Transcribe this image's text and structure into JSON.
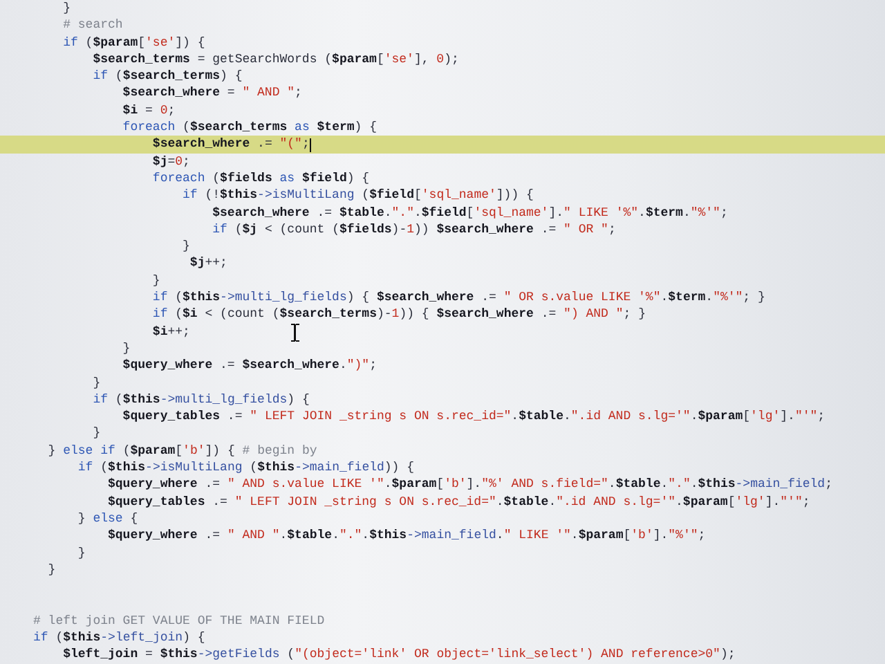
{
  "editor": {
    "lines": [
      {
        "current": false,
        "segments": [
          {
            "kind": "txt",
            "text": "    }"
          }
        ]
      },
      {
        "current": false,
        "segments": [
          {
            "kind": "com",
            "text": "    # search"
          }
        ]
      },
      {
        "current": false,
        "segments": [
          {
            "kind": "kw",
            "text": "    if"
          },
          {
            "kind": "txt",
            "text": " ("
          },
          {
            "kind": "var",
            "text": "$param"
          },
          {
            "kind": "txt",
            "text": "["
          },
          {
            "kind": "str",
            "text": "'se'"
          },
          {
            "kind": "txt",
            "text": "]) {"
          }
        ]
      },
      {
        "current": false,
        "segments": [
          {
            "kind": "var",
            "text": "        $search_terms"
          },
          {
            "kind": "txt",
            "text": " = getSearchWords ("
          },
          {
            "kind": "var",
            "text": "$param"
          },
          {
            "kind": "txt",
            "text": "["
          },
          {
            "kind": "str",
            "text": "'se'"
          },
          {
            "kind": "txt",
            "text": "], "
          },
          {
            "kind": "str",
            "text": "0"
          },
          {
            "kind": "txt",
            "text": ");"
          }
        ]
      },
      {
        "current": false,
        "segments": [
          {
            "kind": "kw",
            "text": "        if"
          },
          {
            "kind": "txt",
            "text": " ("
          },
          {
            "kind": "var",
            "text": "$search_terms"
          },
          {
            "kind": "txt",
            "text": ") {"
          }
        ]
      },
      {
        "current": false,
        "segments": [
          {
            "kind": "var",
            "text": "            $search_where"
          },
          {
            "kind": "txt",
            "text": " = "
          },
          {
            "kind": "str",
            "text": "\" AND \""
          },
          {
            "kind": "txt",
            "text": ";"
          }
        ]
      },
      {
        "current": false,
        "segments": [
          {
            "kind": "var",
            "text": "            $i"
          },
          {
            "kind": "txt",
            "text": " = "
          },
          {
            "kind": "str",
            "text": "0"
          },
          {
            "kind": "txt",
            "text": ";"
          }
        ]
      },
      {
        "current": false,
        "segments": [
          {
            "kind": "kw",
            "text": "            foreach"
          },
          {
            "kind": "txt",
            "text": " ("
          },
          {
            "kind": "var",
            "text": "$search_terms"
          },
          {
            "kind": "kw",
            "text": " as "
          },
          {
            "kind": "var",
            "text": "$term"
          },
          {
            "kind": "txt",
            "text": ") {"
          }
        ]
      },
      {
        "current": true,
        "segments": [
          {
            "kind": "var",
            "text": "                $search_where"
          },
          {
            "kind": "txt",
            "text": " .= "
          },
          {
            "kind": "str",
            "text": "\"(\""
          },
          {
            "kind": "txt",
            "text": ";"
          }
        ]
      },
      {
        "current": false,
        "segments": [
          {
            "kind": "var",
            "text": "                $j"
          },
          {
            "kind": "txt",
            "text": "="
          },
          {
            "kind": "str",
            "text": "0"
          },
          {
            "kind": "txt",
            "text": ";"
          }
        ]
      },
      {
        "current": false,
        "segments": [
          {
            "kind": "kw",
            "text": "                foreach"
          },
          {
            "kind": "txt",
            "text": " ("
          },
          {
            "kind": "var",
            "text": "$fields"
          },
          {
            "kind": "kw",
            "text": " as "
          },
          {
            "kind": "var",
            "text": "$field"
          },
          {
            "kind": "txt",
            "text": ") {"
          }
        ]
      },
      {
        "current": false,
        "segments": [
          {
            "kind": "kw",
            "text": "                    if"
          },
          {
            "kind": "txt",
            "text": " (!"
          },
          {
            "kind": "var",
            "text": "$this"
          },
          {
            "kind": "fn",
            "text": "->isMultiLang"
          },
          {
            "kind": "txt",
            "text": " ("
          },
          {
            "kind": "var",
            "text": "$field"
          },
          {
            "kind": "txt",
            "text": "["
          },
          {
            "kind": "str",
            "text": "'sql_name'"
          },
          {
            "kind": "txt",
            "text": "])) {"
          }
        ]
      },
      {
        "current": false,
        "segments": [
          {
            "kind": "var",
            "text": "                        $search_where"
          },
          {
            "kind": "txt",
            "text": " .= "
          },
          {
            "kind": "var",
            "text": "$table"
          },
          {
            "kind": "txt",
            "text": "."
          },
          {
            "kind": "str",
            "text": "\".\""
          },
          {
            "kind": "txt",
            "text": "."
          },
          {
            "kind": "var",
            "text": "$field"
          },
          {
            "kind": "txt",
            "text": "["
          },
          {
            "kind": "str",
            "text": "'sql_name'"
          },
          {
            "kind": "txt",
            "text": "]."
          },
          {
            "kind": "str",
            "text": "\" LIKE '%\""
          },
          {
            "kind": "txt",
            "text": "."
          },
          {
            "kind": "var",
            "text": "$term"
          },
          {
            "kind": "txt",
            "text": "."
          },
          {
            "kind": "str",
            "text": "\"%'\""
          },
          {
            "kind": "txt",
            "text": ";"
          }
        ]
      },
      {
        "current": false,
        "segments": [
          {
            "kind": "kw",
            "text": "                        if"
          },
          {
            "kind": "txt",
            "text": " ("
          },
          {
            "kind": "var",
            "text": "$j"
          },
          {
            "kind": "txt",
            "text": " < (count ("
          },
          {
            "kind": "var",
            "text": "$fields"
          },
          {
            "kind": "txt",
            "text": ")-"
          },
          {
            "kind": "str",
            "text": "1"
          },
          {
            "kind": "txt",
            "text": ")) "
          },
          {
            "kind": "var",
            "text": "$search_where"
          },
          {
            "kind": "txt",
            "text": " .= "
          },
          {
            "kind": "str",
            "text": "\" OR \""
          },
          {
            "kind": "txt",
            "text": ";"
          }
        ]
      },
      {
        "current": false,
        "segments": [
          {
            "kind": "txt",
            "text": "                    }"
          }
        ]
      },
      {
        "current": false,
        "segments": [
          {
            "kind": "var",
            "text": "                     $j"
          },
          {
            "kind": "txt",
            "text": "++;"
          }
        ]
      },
      {
        "current": false,
        "segments": [
          {
            "kind": "txt",
            "text": "                }"
          }
        ]
      },
      {
        "current": false,
        "segments": [
          {
            "kind": "kw",
            "text": "                if"
          },
          {
            "kind": "txt",
            "text": " ("
          },
          {
            "kind": "var",
            "text": "$this"
          },
          {
            "kind": "fn",
            "text": "->multi_lg_fields"
          },
          {
            "kind": "txt",
            "text": ") { "
          },
          {
            "kind": "var",
            "text": "$search_where"
          },
          {
            "kind": "txt",
            "text": " .= "
          },
          {
            "kind": "str",
            "text": "\" OR s.value LIKE '%\""
          },
          {
            "kind": "txt",
            "text": "."
          },
          {
            "kind": "var",
            "text": "$term"
          },
          {
            "kind": "txt",
            "text": "."
          },
          {
            "kind": "str",
            "text": "\"%'\""
          },
          {
            "kind": "txt",
            "text": "; }"
          }
        ]
      },
      {
        "current": false,
        "segments": [
          {
            "kind": "kw",
            "text": "                if"
          },
          {
            "kind": "txt",
            "text": " ("
          },
          {
            "kind": "var",
            "text": "$i"
          },
          {
            "kind": "txt",
            "text": " < (count ("
          },
          {
            "kind": "var",
            "text": "$search_terms"
          },
          {
            "kind": "txt",
            "text": ")-"
          },
          {
            "kind": "str",
            "text": "1"
          },
          {
            "kind": "txt",
            "text": ")) { "
          },
          {
            "kind": "var",
            "text": "$search_where"
          },
          {
            "kind": "txt",
            "text": " .= "
          },
          {
            "kind": "str",
            "text": "\") AND \""
          },
          {
            "kind": "txt",
            "text": "; }"
          }
        ]
      },
      {
        "current": false,
        "segments": [
          {
            "kind": "var",
            "text": "                $i"
          },
          {
            "kind": "txt",
            "text": "++;"
          }
        ]
      },
      {
        "current": false,
        "segments": [
          {
            "kind": "txt",
            "text": "            }"
          }
        ]
      },
      {
        "current": false,
        "segments": [
          {
            "kind": "var",
            "text": "            $query_where"
          },
          {
            "kind": "txt",
            "text": " .= "
          },
          {
            "kind": "var",
            "text": "$search_where"
          },
          {
            "kind": "txt",
            "text": "."
          },
          {
            "kind": "str",
            "text": "\")\""
          },
          {
            "kind": "txt",
            "text": ";"
          }
        ]
      },
      {
        "current": false,
        "segments": [
          {
            "kind": "txt",
            "text": "        }"
          }
        ]
      },
      {
        "current": false,
        "segments": [
          {
            "kind": "kw",
            "text": "        if"
          },
          {
            "kind": "txt",
            "text": " ("
          },
          {
            "kind": "var",
            "text": "$this"
          },
          {
            "kind": "fn",
            "text": "->multi_lg_fields"
          },
          {
            "kind": "txt",
            "text": ") {"
          }
        ]
      },
      {
        "current": false,
        "segments": [
          {
            "kind": "var",
            "text": "            $query_tables"
          },
          {
            "kind": "txt",
            "text": " .= "
          },
          {
            "kind": "str",
            "text": "\" LEFT JOIN _string s ON s.rec_id=\""
          },
          {
            "kind": "txt",
            "text": "."
          },
          {
            "kind": "var",
            "text": "$table"
          },
          {
            "kind": "txt",
            "text": "."
          },
          {
            "kind": "str",
            "text": "\".id AND s.lg='\""
          },
          {
            "kind": "txt",
            "text": "."
          },
          {
            "kind": "var",
            "text": "$param"
          },
          {
            "kind": "txt",
            "text": "["
          },
          {
            "kind": "str",
            "text": "'lg'"
          },
          {
            "kind": "txt",
            "text": "]."
          },
          {
            "kind": "str",
            "text": "\"'\""
          },
          {
            "kind": "txt",
            "text": ";"
          }
        ]
      },
      {
        "current": false,
        "segments": [
          {
            "kind": "txt",
            "text": "        }"
          }
        ]
      },
      {
        "current": false,
        "segments": [
          {
            "kind": "txt",
            "text": "  } "
          },
          {
            "kind": "kw",
            "text": "else if"
          },
          {
            "kind": "txt",
            "text": " ("
          },
          {
            "kind": "var",
            "text": "$param"
          },
          {
            "kind": "txt",
            "text": "["
          },
          {
            "kind": "str",
            "text": "'b'"
          },
          {
            "kind": "txt",
            "text": "]) { "
          },
          {
            "kind": "com",
            "text": "# begin by"
          }
        ]
      },
      {
        "current": false,
        "segments": [
          {
            "kind": "kw",
            "text": "      if"
          },
          {
            "kind": "txt",
            "text": " ("
          },
          {
            "kind": "var",
            "text": "$this"
          },
          {
            "kind": "fn",
            "text": "->isMultiLang"
          },
          {
            "kind": "txt",
            "text": " ("
          },
          {
            "kind": "var",
            "text": "$this"
          },
          {
            "kind": "fn",
            "text": "->main_field"
          },
          {
            "kind": "txt",
            "text": ")) {"
          }
        ]
      },
      {
        "current": false,
        "segments": [
          {
            "kind": "var",
            "text": "          $query_where"
          },
          {
            "kind": "txt",
            "text": " .= "
          },
          {
            "kind": "str",
            "text": "\" AND s.value LIKE '\""
          },
          {
            "kind": "txt",
            "text": "."
          },
          {
            "kind": "var",
            "text": "$param"
          },
          {
            "kind": "txt",
            "text": "["
          },
          {
            "kind": "str",
            "text": "'b'"
          },
          {
            "kind": "txt",
            "text": "]."
          },
          {
            "kind": "str",
            "text": "\"%' AND s.field=\""
          },
          {
            "kind": "txt",
            "text": "."
          },
          {
            "kind": "var",
            "text": "$table"
          },
          {
            "kind": "txt",
            "text": "."
          },
          {
            "kind": "str",
            "text": "\".\""
          },
          {
            "kind": "txt",
            "text": "."
          },
          {
            "kind": "var",
            "text": "$this"
          },
          {
            "kind": "fn",
            "text": "->main_field"
          },
          {
            "kind": "txt",
            "text": ";"
          }
        ]
      },
      {
        "current": false,
        "segments": [
          {
            "kind": "var",
            "text": "          $query_tables"
          },
          {
            "kind": "txt",
            "text": " .= "
          },
          {
            "kind": "str",
            "text": "\" LEFT JOIN _string s ON s.rec_id=\""
          },
          {
            "kind": "txt",
            "text": "."
          },
          {
            "kind": "var",
            "text": "$table"
          },
          {
            "kind": "txt",
            "text": "."
          },
          {
            "kind": "str",
            "text": "\".id AND s.lg='\""
          },
          {
            "kind": "txt",
            "text": "."
          },
          {
            "kind": "var",
            "text": "$param"
          },
          {
            "kind": "txt",
            "text": "["
          },
          {
            "kind": "str",
            "text": "'lg'"
          },
          {
            "kind": "txt",
            "text": "]."
          },
          {
            "kind": "str",
            "text": "\"'\""
          },
          {
            "kind": "txt",
            "text": ";"
          }
        ]
      },
      {
        "current": false,
        "segments": [
          {
            "kind": "txt",
            "text": "      } "
          },
          {
            "kind": "kw",
            "text": "else"
          },
          {
            "kind": "txt",
            "text": " {"
          }
        ]
      },
      {
        "current": false,
        "segments": [
          {
            "kind": "var",
            "text": "          $query_where"
          },
          {
            "kind": "txt",
            "text": " .= "
          },
          {
            "kind": "str",
            "text": "\" AND \""
          },
          {
            "kind": "txt",
            "text": "."
          },
          {
            "kind": "var",
            "text": "$table"
          },
          {
            "kind": "txt",
            "text": "."
          },
          {
            "kind": "str",
            "text": "\".\""
          },
          {
            "kind": "txt",
            "text": "."
          },
          {
            "kind": "var",
            "text": "$this"
          },
          {
            "kind": "fn",
            "text": "->main_field"
          },
          {
            "kind": "txt",
            "text": "."
          },
          {
            "kind": "str",
            "text": "\" LIKE '\""
          },
          {
            "kind": "txt",
            "text": "."
          },
          {
            "kind": "var",
            "text": "$param"
          },
          {
            "kind": "txt",
            "text": "["
          },
          {
            "kind": "str",
            "text": "'b'"
          },
          {
            "kind": "txt",
            "text": "]."
          },
          {
            "kind": "str",
            "text": "\"%'\""
          },
          {
            "kind": "txt",
            "text": ";"
          }
        ]
      },
      {
        "current": false,
        "segments": [
          {
            "kind": "txt",
            "text": "      }"
          }
        ]
      },
      {
        "current": false,
        "segments": [
          {
            "kind": "txt",
            "text": "  }"
          }
        ]
      },
      {
        "current": false
      },
      {
        "current": false
      },
      {
        "current": false,
        "segments": [
          {
            "kind": "com",
            "text": "# left join GET VALUE OF THE MAIN FIELD"
          }
        ]
      },
      {
        "current": false,
        "segments": [
          {
            "kind": "kw",
            "text": "if"
          },
          {
            "kind": "txt",
            "text": " ("
          },
          {
            "kind": "var",
            "text": "$this"
          },
          {
            "kind": "fn",
            "text": "->left_join"
          },
          {
            "kind": "txt",
            "text": ") {"
          }
        ]
      },
      {
        "current": false,
        "segments": [
          {
            "kind": "var",
            "text": "    $left_join"
          },
          {
            "kind": "txt",
            "text": " = "
          },
          {
            "kind": "var",
            "text": "$this"
          },
          {
            "kind": "fn",
            "text": "->getFields"
          },
          {
            "kind": "txt",
            "text": " ("
          },
          {
            "kind": "str",
            "text": "\"(object='link' OR object='link_select') AND reference>0\""
          },
          {
            "kind": "txt",
            "text": ");"
          }
        ]
      }
    ]
  }
}
